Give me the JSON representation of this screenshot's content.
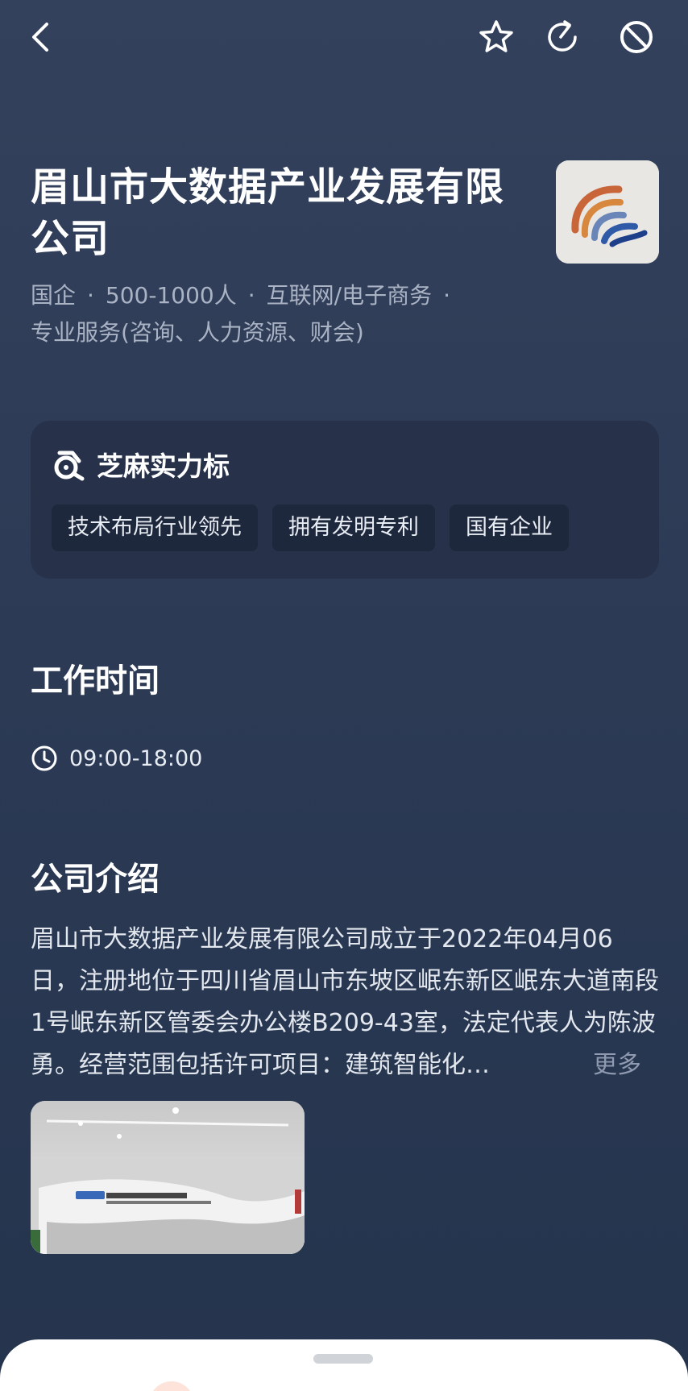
{
  "topbar": {
    "icons": [
      "back-icon",
      "star-icon",
      "share-icon",
      "block-icon"
    ]
  },
  "company": {
    "name": "眉山市大数据产业发展有限公司",
    "tags": [
      "国企",
      "500-1000人",
      "互联网/电子商务",
      "专业服务(咨询、人力资源、财会)"
    ]
  },
  "zhima": {
    "title": "芝麻实力标",
    "tags": [
      "技术布局行业领先",
      "拥有发明专利",
      "国有企业"
    ]
  },
  "worktime": {
    "title": "工作时间",
    "hours": "09:00-18:00"
  },
  "intro": {
    "title": "公司介绍",
    "text": "眉山市大数据产业发展有限公司成立于2022年04月06日，注册地位于四川省眉山市东坡区岷东新区岷东大道南段1号岷东新区管委会办公楼B209-43室，法定代表人为陈波勇。经营范围包括许可项目：建筑智能化…",
    "more": "更多"
  },
  "photo": {
    "sign_cn": "眉山市大数据产业发展有限公司",
    "sign_en": "Meishan Big Data Industry Development Co.,Ltd",
    "badge": "眉山国资"
  },
  "colors": {
    "background": "#2d3b56",
    "card": "#27324a",
    "tag": "#1e283c",
    "muted": "#aab3c4"
  }
}
